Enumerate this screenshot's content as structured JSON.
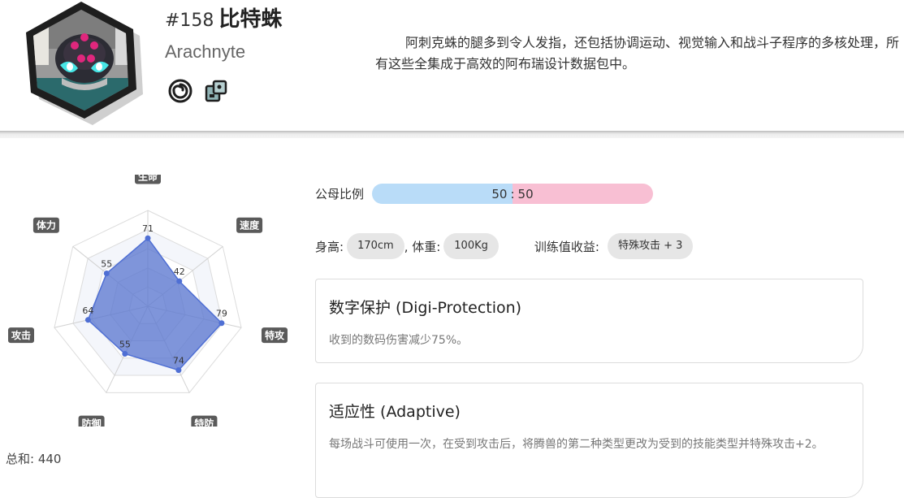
{
  "header": {
    "number": "#158",
    "name_cn": "比特蛛",
    "name_en": "Arachnyte",
    "description": "阿刺克蛛的腿多到令人发指，还包括协调运动、视觉输入和战斗子程序的多核处理，所有这些全集成于高效的阿布瑞设计数据包中。",
    "type_icons": [
      "spiral-type-icon",
      "circuit-type-icon"
    ]
  },
  "stats": {
    "labels": [
      "生命",
      "速度",
      "特攻",
      "特防",
      "防御",
      "攻击",
      "体力"
    ],
    "values": [
      71,
      42,
      79,
      74,
      55,
      64,
      55
    ],
    "max": 100,
    "total_label": "总和: 440"
  },
  "info": {
    "gender_label": "公母比例",
    "gender_male": "50",
    "gender_separator": ":",
    "gender_female": "50",
    "gender_male_ratio": 0.5,
    "height_label": "身高:",
    "height_value": "170cm",
    "weight_label": ", 体重:",
    "weight_value": "100Kg",
    "ev_label": "训练值收益:",
    "ev_value": "特殊攻击 + 3"
  },
  "abilities": [
    {
      "title": "数字保护 (Digi-Protection)",
      "desc": "收到的数码伤害减少75%。"
    },
    {
      "title": "适应性 (Adaptive)",
      "desc": "每场战斗可使用一次，在受到攻击后，将腾兽的第二种类型更改为受到的技能类型并特殊攻击+2。"
    }
  ],
  "colors": {
    "radar_fill": "#5b77d0",
    "radar_point": "#4f6fd4",
    "label_bg": "#5a5a5a",
    "male_bar": "#b9dcf8",
    "female_bar": "#f8bfd3",
    "chip_bg": "#e6e6e6"
  }
}
